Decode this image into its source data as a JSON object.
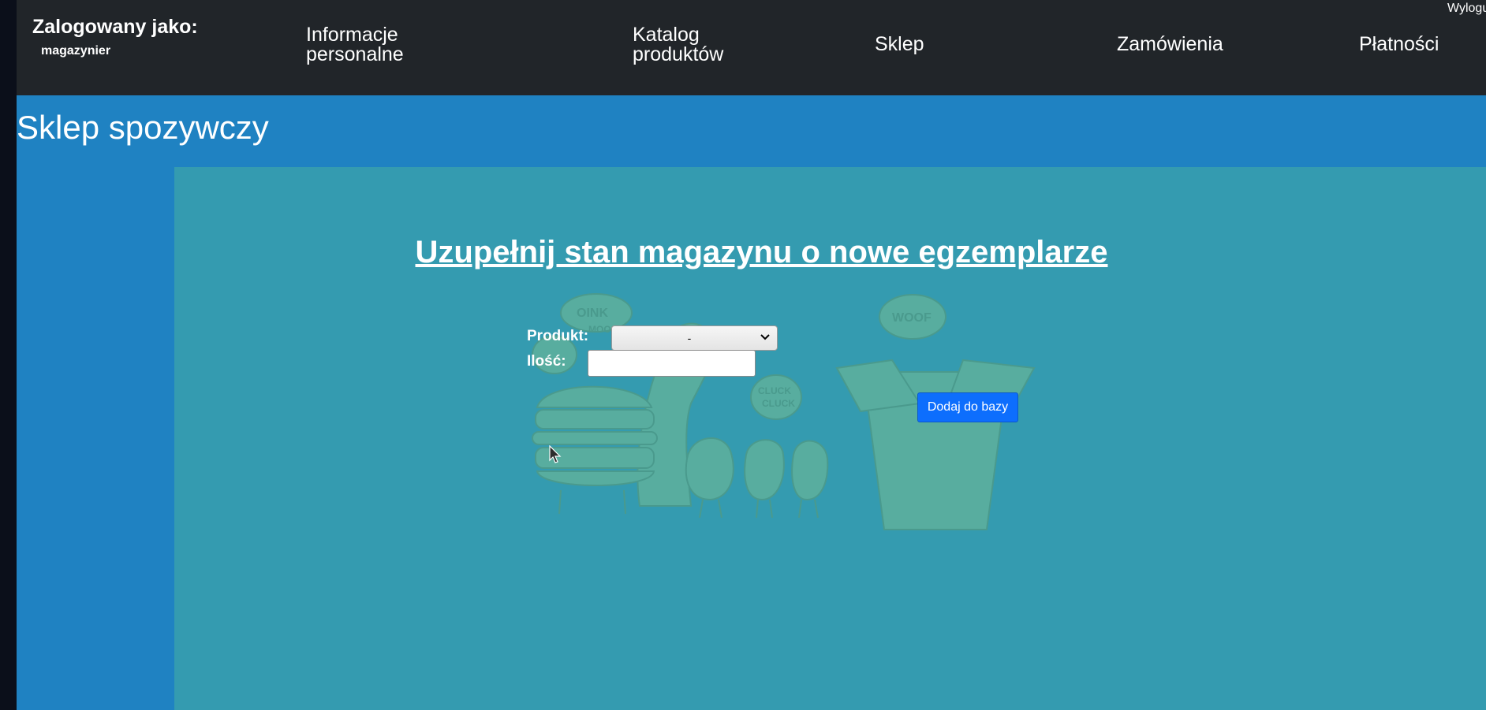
{
  "navbar": {
    "logged_in_label": "Zalogowany jako:",
    "username": "magazynier",
    "items": [
      {
        "label": "Informacje personalne"
      },
      {
        "label": "Katalog produktów"
      },
      {
        "label": "Sklep"
      },
      {
        "label": "Zamówienia"
      },
      {
        "label": "Płatności"
      }
    ],
    "logout_label": "Wylogu"
  },
  "header": {
    "title": "Sklep spozywczy"
  },
  "form": {
    "heading": "Uzupełnij stan magazynu o nowe egzemplarze",
    "product_label": "Produkt:",
    "product_selected": "-",
    "quantity_label": "Ilość:",
    "quantity_value": "",
    "submit_label": "Dodaj do bazy"
  },
  "illustration": {
    "bubbles": [
      "OINK",
      "MOO",
      "WOOF",
      "CLUCK",
      "CLUCK"
    ]
  },
  "colors": {
    "navbar_bg": "#212529",
    "page_bg": "#1f82c2",
    "content_bg": "#349bb0",
    "button_bg": "#0d6efd",
    "illustration_tint": "#5fb5a8"
  }
}
